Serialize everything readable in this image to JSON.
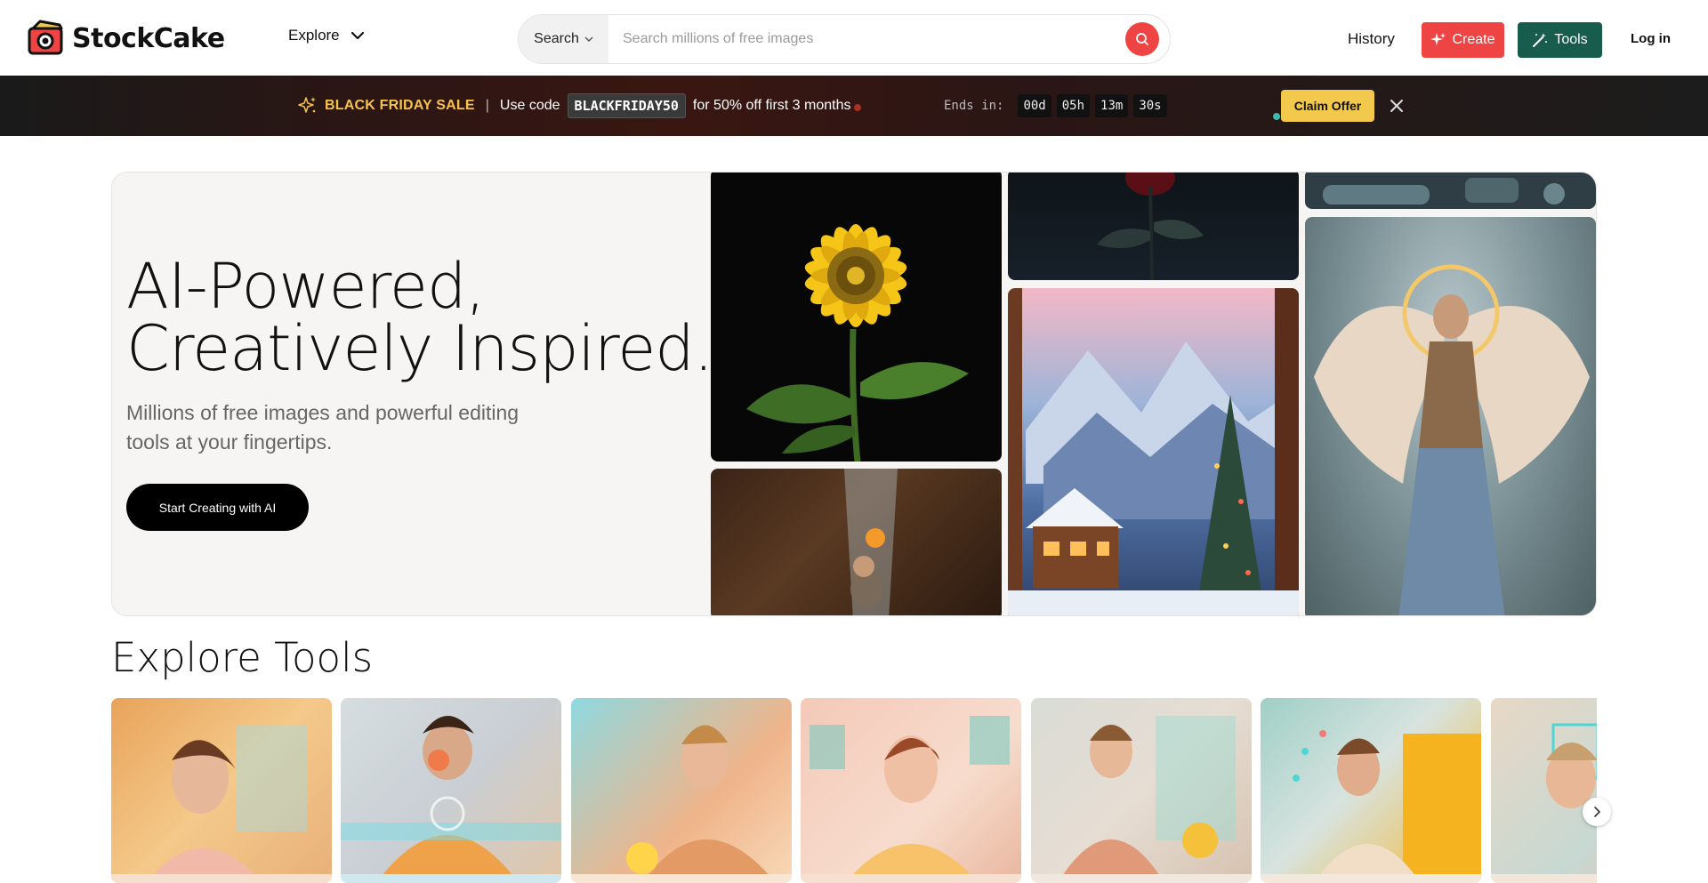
{
  "header": {
    "logo_text": "StockCake",
    "explore_label": "Explore",
    "search_scope": "Search",
    "search_placeholder": "Search millions of free images",
    "history_label": "History",
    "create_label": "Create",
    "tools_label": "Tools",
    "login_label": "Log in"
  },
  "promo": {
    "title": "BLACK FRIDAY SALE",
    "separator": "|",
    "use_code_text": "Use code",
    "code": "BLACKFRIDAY50",
    "offer_text": "for 50% off first 3 months",
    "ends_label": "Ends in:",
    "days": "00d",
    "hours": "05h",
    "minutes": "13m",
    "seconds": "30s",
    "claim_label": "Claim Offer"
  },
  "hero": {
    "title_line1": "AI-Powered,",
    "title_line2": "Creatively Inspired.",
    "subtitle": "Millions of free images and powerful editing tools at your fingertips.",
    "cta_label": "Start Creating with AI"
  },
  "tools_section": {
    "title": "Explore Tools"
  },
  "colors": {
    "brand_red": "#ef4444",
    "brand_green": "#175c4c",
    "promo_gold": "#f5c24c",
    "claim_yellow": "#f2c94c"
  },
  "icons": {
    "explore_chevron": "chevron-down-icon",
    "search": "search-icon",
    "create": "sparkle-icon",
    "tools": "magic-wand-icon",
    "promo": "sparkle-icon",
    "close": "close-icon",
    "carousel_next": "chevron-right-icon"
  }
}
